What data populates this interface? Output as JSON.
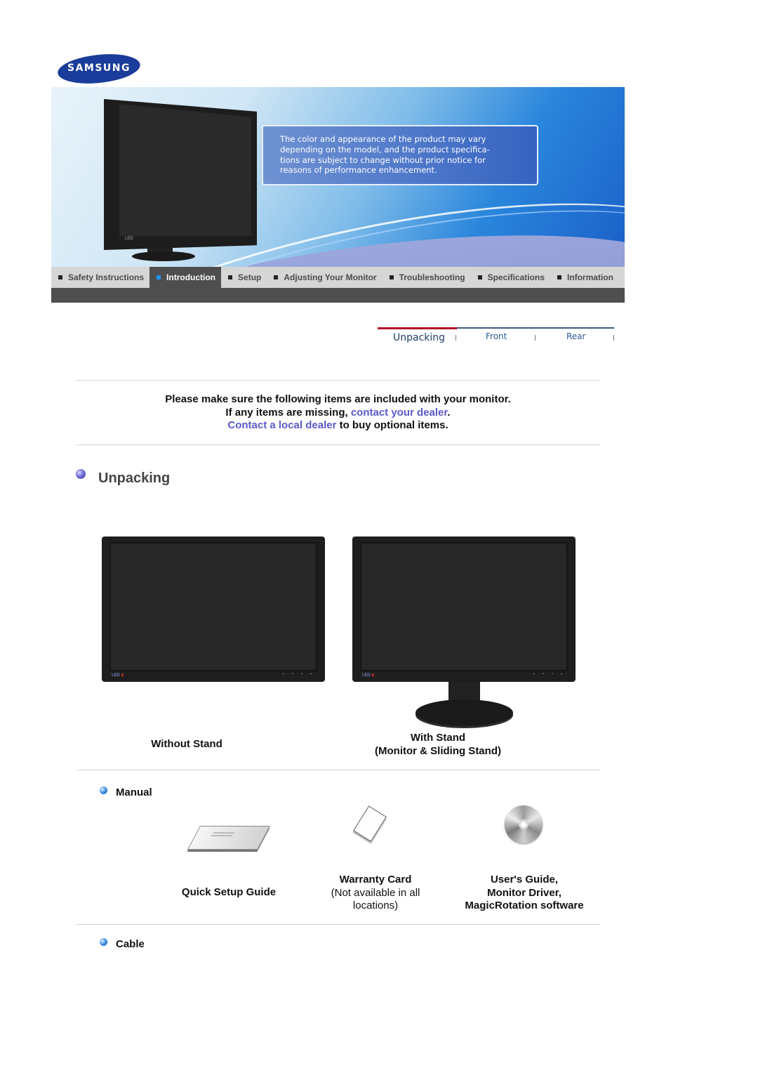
{
  "brand": {
    "logo_text": "SAMSUNG",
    "logo_color": "#1a3c9a"
  },
  "banner": {
    "notice": "The color and appearance of the product may vary depending on the model, and the product specifica-tions are subject to change without prior notice for reasons of performance enhancement.",
    "notice_lines": [
      "The color and appearance of the product may vary",
      "depending on the model, and the product specifica-",
      "tions are subject to change without prior notice for",
      "reasons of performance enhancement."
    ],
    "monitor_badge": "LED"
  },
  "nav": {
    "items": [
      {
        "label": "Safety Instructions",
        "active": false
      },
      {
        "label": "Introduction",
        "active": true
      },
      {
        "label": "Setup",
        "active": false
      },
      {
        "label": "Adjusting Your Monitor",
        "active": false
      },
      {
        "label": "Troubleshooting",
        "active": false
      },
      {
        "label": "Specifications",
        "active": false
      },
      {
        "label": "Information",
        "active": false
      }
    ],
    "active_color": "#1e90ff"
  },
  "subtabs": {
    "items": [
      {
        "label": "Unpacking",
        "active": true
      },
      {
        "label": "Front",
        "active": false
      },
      {
        "label": "Rear",
        "active": false
      }
    ],
    "active_color": "#b3122a"
  },
  "intro": {
    "line1": "Please make sure the following items are included with your monitor.",
    "line2_prefix": "If any items are missing, ",
    "line2_link": "contact your dealer",
    "line2_suffix": ".",
    "line3_link": "Contact a local dealer",
    "line3_suffix": " to buy optional items.",
    "link_color": "#5a5ac8"
  },
  "section": {
    "title": "Unpacking"
  },
  "monitors": {
    "led_label": "LED",
    "without_stand": "Without Stand",
    "with_stand_line1": "With Stand",
    "with_stand_line2": "(Monitor & Sliding Stand)"
  },
  "manual": {
    "heading": "Manual",
    "items": [
      {
        "icon": "booklet-icon",
        "lines": [
          "Quick Setup Guide"
        ]
      },
      {
        "icon": "warranty-card-icon",
        "title": "Warranty Card",
        "note_line1": "(Not available in all",
        "note_line2": "locations)"
      },
      {
        "icon": "cd-icon",
        "lines": [
          "User's Guide,",
          "Monitor Driver,",
          "MagicRotation software"
        ]
      }
    ]
  },
  "cable": {
    "heading": "Cable"
  }
}
